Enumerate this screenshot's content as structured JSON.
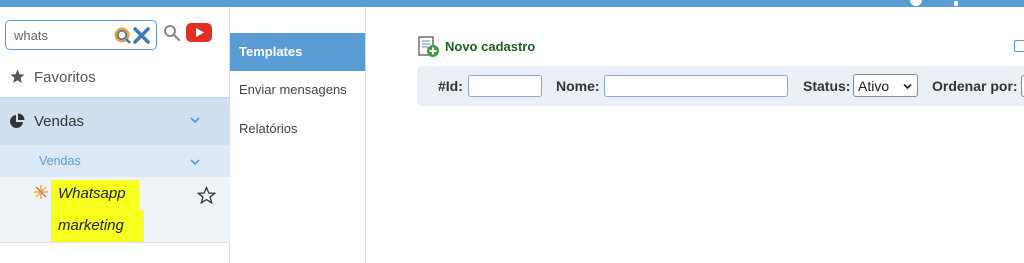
{
  "sidebar": {
    "search": {
      "value": "whats"
    },
    "favorites_label": "Favoritos",
    "menu_group": "Vendas",
    "submenu_group": "Vendas",
    "item": {
      "line1": "Whatsapp",
      "line2": "marketing"
    }
  },
  "subnav": {
    "items": [
      {
        "label": "Templates"
      },
      {
        "label": "Enviar mensagens"
      },
      {
        "label": "Relatórios"
      }
    ]
  },
  "main": {
    "new_label": "Novo cadastro",
    "filters": {
      "id_label": "#Id:",
      "id_value": "",
      "name_label": "Nome:",
      "name_value": "",
      "status_label": "Status:",
      "status_value": "Ativo",
      "order_label": "Ordenar por:"
    }
  },
  "colors": {
    "accent": "#5b9bd5",
    "highlight": "#f7ff1f",
    "youtube": "#e52d27",
    "new_label": "#1f5f1f"
  }
}
